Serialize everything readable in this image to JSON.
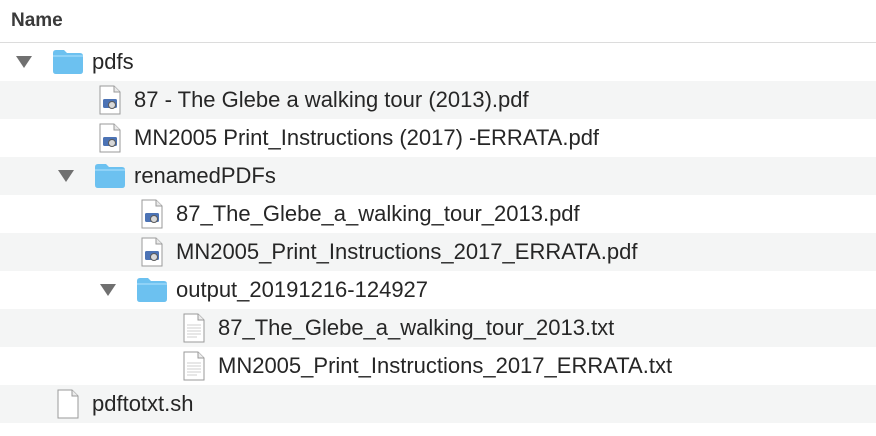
{
  "header": {
    "column_name": "Name"
  },
  "rows": [
    {
      "name": "pdfs",
      "kind": "folder",
      "expanded": true
    },
    {
      "name": "87 - The Glebe  a walking tour (2013).pdf",
      "kind": "pdf"
    },
    {
      "name": "MN2005 Print_Instructions (2017) -ERRATA.pdf",
      "kind": "pdf"
    },
    {
      "name": "renamedPDFs",
      "kind": "folder",
      "expanded": true
    },
    {
      "name": "87_The_Glebe_a_walking_tour_2013.pdf",
      "kind": "pdf"
    },
    {
      "name": "MN2005_Print_Instructions_2017_ERRATA.pdf",
      "kind": "pdf"
    },
    {
      "name": "output_20191216-124927",
      "kind": "folder",
      "expanded": true
    },
    {
      "name": "87_The_Glebe_a_walking_tour_2013.txt",
      "kind": "txt"
    },
    {
      "name": "MN2005_Print_Instructions_2017_ERRATA.txt",
      "kind": "txt"
    },
    {
      "name": "pdftotxt.sh",
      "kind": "txt"
    }
  ],
  "colors": {
    "folder": "#6cc1f0",
    "folder_tab": "#8fd2f7",
    "stripe": "#f4f5f5",
    "disclosure": "#707070"
  }
}
